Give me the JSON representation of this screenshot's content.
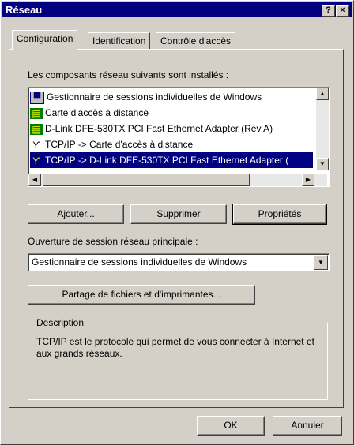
{
  "window": {
    "title": "Réseau",
    "help_label": "?",
    "close_label": "×"
  },
  "tabs": [
    {
      "label": "Configuration",
      "active": true
    },
    {
      "label": "Identification",
      "active": false
    },
    {
      "label": "Contrôle d'accès",
      "active": false
    }
  ],
  "components": {
    "label": "Les composants réseau suivants sont installés :",
    "items": [
      {
        "icon": "client-icon",
        "text": "Gestionnaire de sessions individuelles de Windows",
        "selected": false
      },
      {
        "icon": "adapter-icon",
        "text": "Carte d'accès à distance",
        "selected": false
      },
      {
        "icon": "adapter-icon",
        "text": "D-Link DFE-530TX PCI Fast Ethernet Adapter (Rev A)",
        "selected": false
      },
      {
        "icon": "protocol-icon",
        "text": "TCP/IP -> Carte d'accès à distance",
        "selected": false
      },
      {
        "icon": "protocol-icon",
        "text": "TCP/IP -> D-Link DFE-530TX PCI Fast Ethernet Adapter (",
        "selected": true
      }
    ]
  },
  "buttons": {
    "add": "Ajouter...",
    "remove": "Supprimer",
    "properties": "Propriétés"
  },
  "primary_logon": {
    "label": "Ouverture de session réseau principale :",
    "value": "Gestionnaire de sessions individuelles de Windows"
  },
  "sharing_button": "Partage de fichiers et d'imprimantes...",
  "description": {
    "legend": "Description",
    "text": "TCP/IP est le protocole qui permet de vous connecter à Internet et aux grands réseaux."
  },
  "footer": {
    "ok": "OK",
    "cancel": "Annuler"
  },
  "colors": {
    "face": "#d4d0c8",
    "title_bar": "#000080",
    "selection": "#000080"
  }
}
